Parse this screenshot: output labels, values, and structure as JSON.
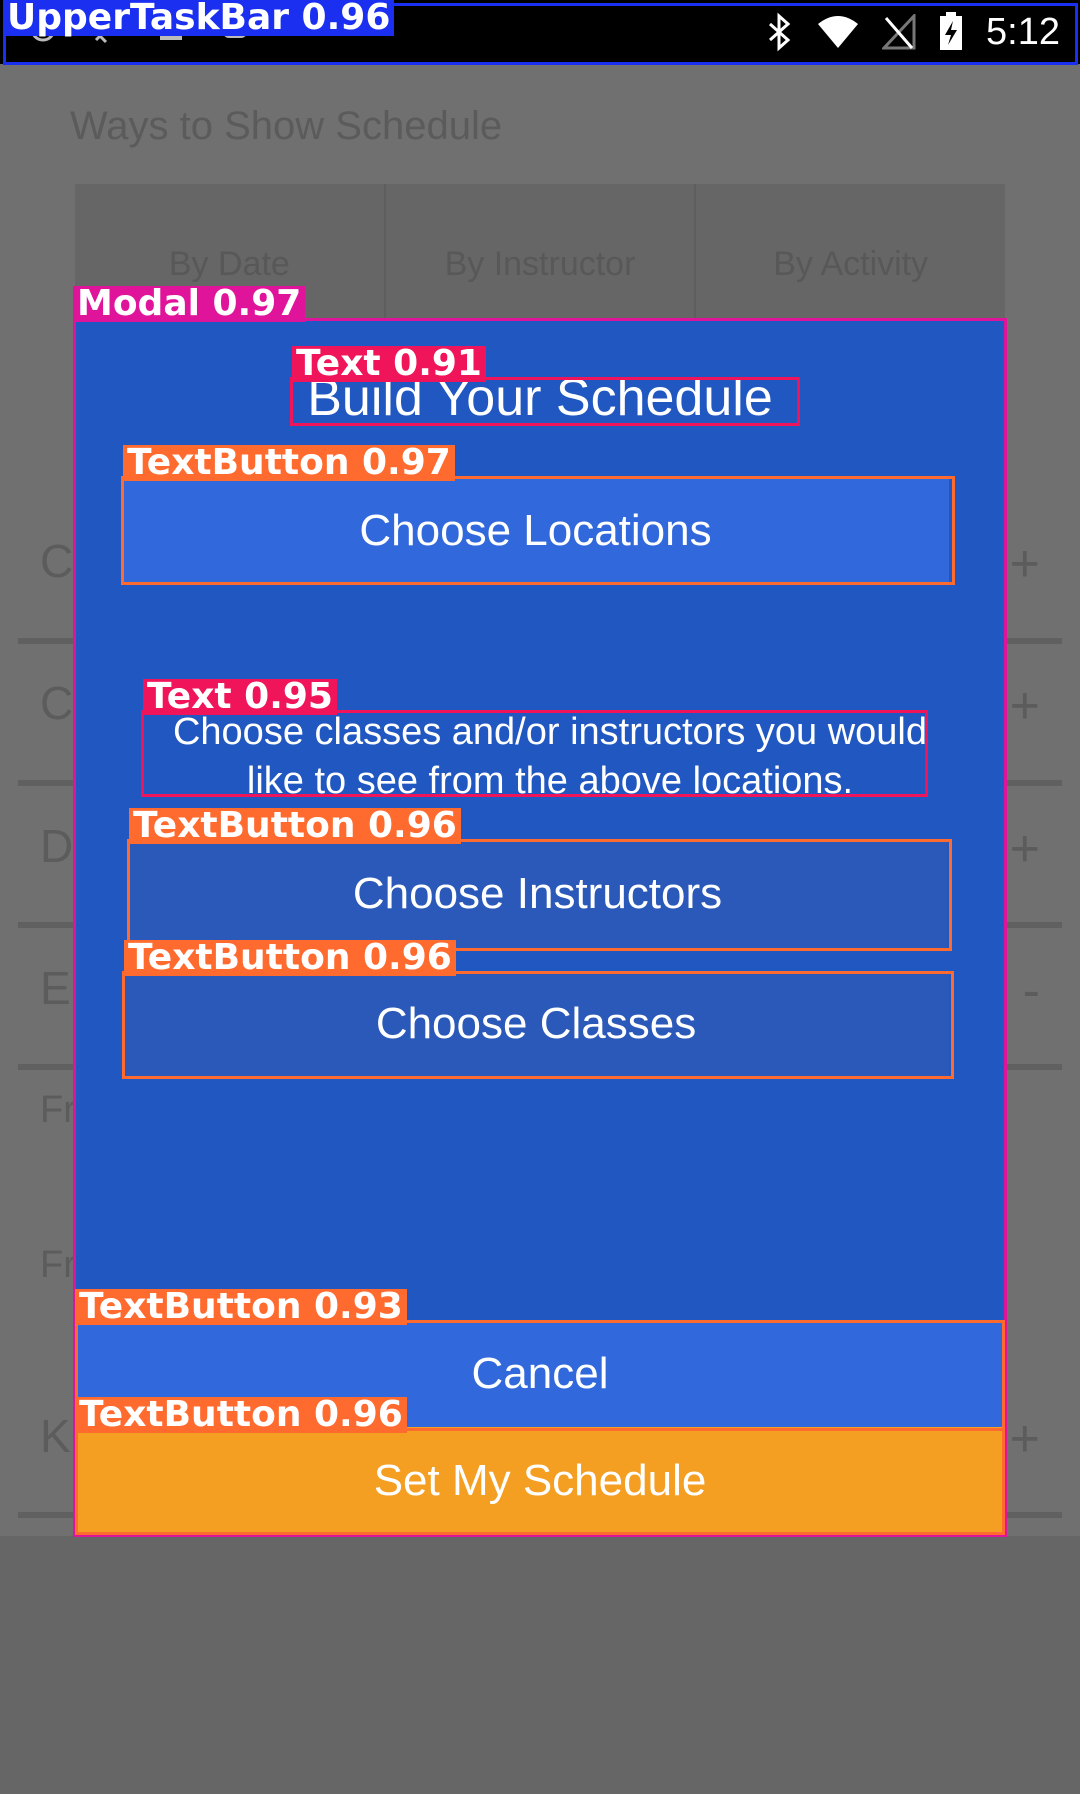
{
  "status_bar": {
    "time": "5:12",
    "annotation": "UpperTaskBar  0.96"
  },
  "background": {
    "title": "Ways to Show Schedule",
    "tabs": [
      "By Date",
      "By Instructor",
      "By Activity"
    ],
    "row_letters": [
      "C",
      "C",
      "D",
      "E",
      "Fr",
      "Fr",
      "K"
    ],
    "row_signs": [
      "+",
      "+",
      "+",
      "-",
      "",
      "",
      "+"
    ]
  },
  "modal": {
    "annotation": "Modal  0.97",
    "title": "Build Your Schedule",
    "title_annotation": "Text  0.91",
    "choose_locations": "Choose Locations",
    "choose_locations_annotation": "TextButton  0.97",
    "instructions": "Choose classes and/or instructors you would like to see from the above locations.",
    "instructions_annotation": "Text  0.95",
    "choose_instructors": "Choose Instructors",
    "choose_instructors_annotation": "TextButton  0.96",
    "choose_classes": "Choose Classes",
    "choose_classes_annotation": "TextButton  0.96",
    "cancel": "Cancel",
    "cancel_annotation": "TextButton  0.93",
    "set_schedule": "Set My Schedule",
    "set_schedule_annotation": "TextButton  0.96"
  },
  "colors": {
    "modal_bg": "#2157c1",
    "primary_button": "#3169dd",
    "accent_button": "#f49e22",
    "annotation_modal": "#e0149b",
    "annotation_text": "#f0145a",
    "annotation_button": "#ff6a2e",
    "annotation_taskbar": "#1a2ff0"
  }
}
